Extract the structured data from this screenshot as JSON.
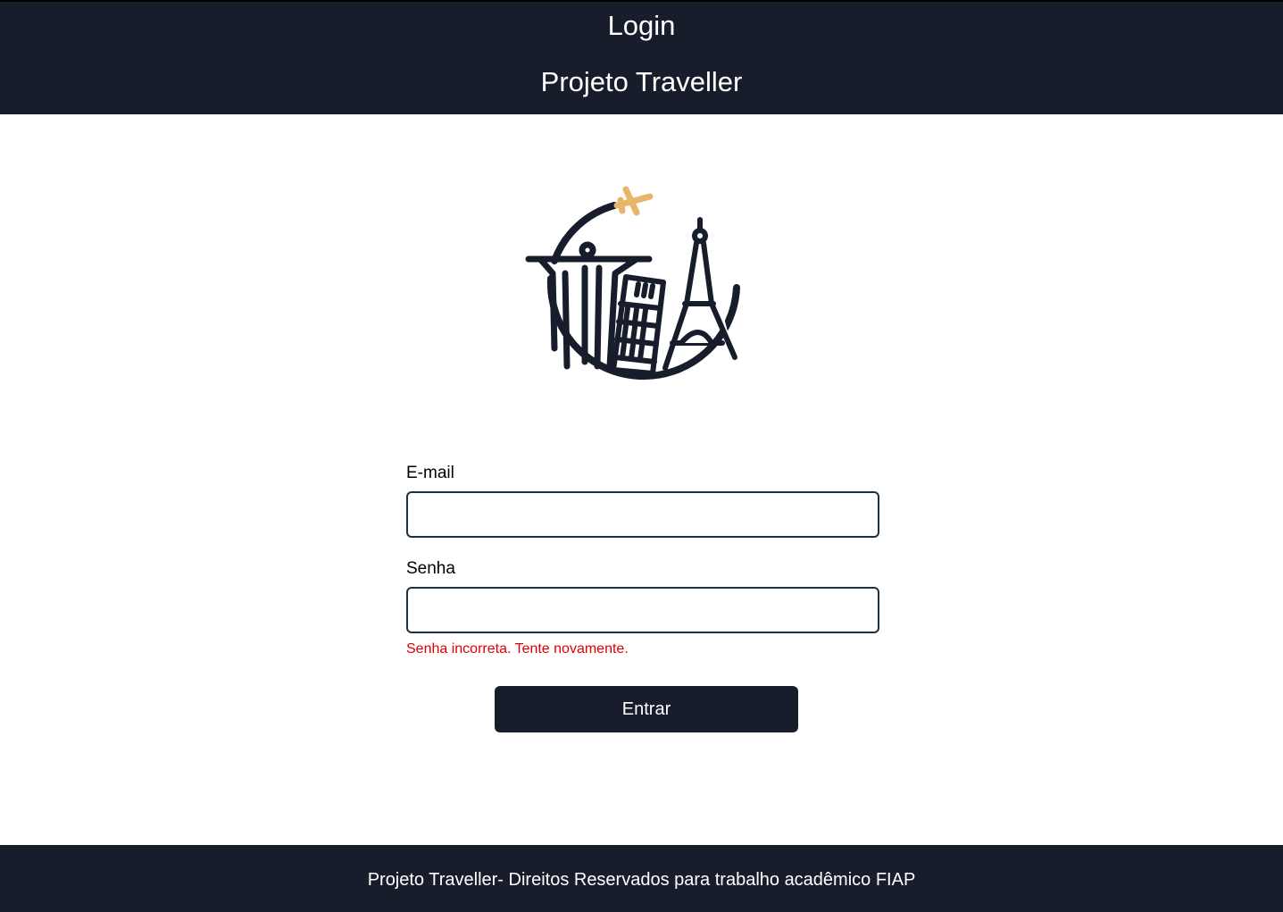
{
  "header": {
    "title": "Login",
    "subtitle": "Projeto Traveller"
  },
  "logo": {
    "icon": "travel-landmarks-logo",
    "colors": {
      "primary": "#181d2c",
      "accent": "#e8b56a"
    }
  },
  "form": {
    "email": {
      "label": "E-mail",
      "value": "",
      "placeholder": ""
    },
    "password": {
      "label": "Senha",
      "value": "",
      "placeholder": ""
    },
    "error": "Senha incorreta. Tente novamente.",
    "submit_label": "Entrar"
  },
  "footer": {
    "text": "Projeto Traveller- Direitos Reservados para trabalho acadêmico FIAP"
  },
  "colors": {
    "navy": "#181d2c",
    "error": "#e00000",
    "input_border": "#1d3143"
  }
}
